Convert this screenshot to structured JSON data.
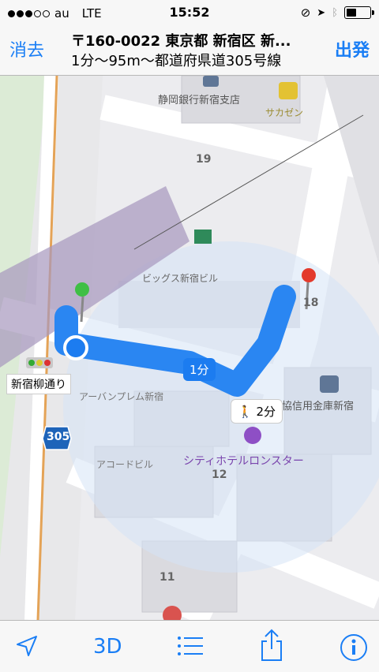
{
  "status": {
    "carrier": "au",
    "network": "LTE",
    "time": "15:52"
  },
  "nav": {
    "clear_label": "消去",
    "title_line1": "〒160-0022 東京都 新宿区 新...",
    "title_line2": "1分〜95m〜都道府県道305号線",
    "start_label": "出発"
  },
  "map": {
    "labels": {
      "bank": "静岡銀行新宿支店",
      "sakazen": "サカゼン",
      "building": "ビッグス新宿ビル",
      "street": "新宿柳通り",
      "apart": "アーバンプレム新宿",
      "acord": "アコードビル",
      "hotel": "シティホテルロンスター",
      "credit": "三協信用金庫新宿",
      "route_shield": "305"
    },
    "blocks": [
      "19",
      "18",
      "12",
      "11"
    ],
    "route_time": "1分",
    "walk_time": "2分"
  },
  "colors": {
    "accent": "#1a7ef5",
    "route": "#2a86f2",
    "purple_zone": "#a797bd",
    "map_bg": "#e8e8ea"
  },
  "toolbar": {
    "view_label": "3D"
  }
}
